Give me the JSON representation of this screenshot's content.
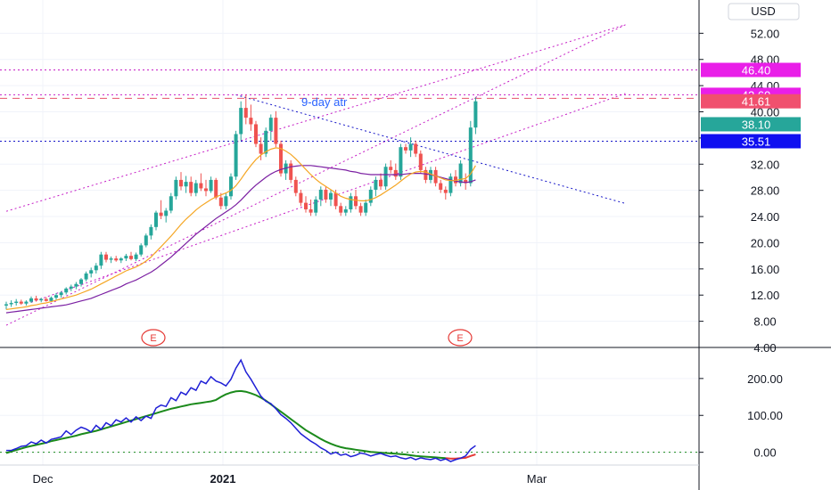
{
  "currency_label": "USD",
  "price_axis": {
    "ticks": [
      "52.00",
      "48.00",
      "44.00",
      "40.00",
      "36.00",
      "32.00",
      "28.00",
      "24.00",
      "20.00",
      "16.00",
      "12.00",
      "8.00",
      "4.00"
    ],
    "range": [
      4,
      53
    ]
  },
  "osc_axis": {
    "ticks": [
      "200.00",
      "100.00",
      "0.00"
    ],
    "range": [
      -25,
      260
    ]
  },
  "date_labels": [
    {
      "text": "Dec",
      "bold": false
    },
    {
      "text": "2021",
      "bold": true
    },
    {
      "text": "Mar",
      "bold": false
    }
  ],
  "price_tags": [
    {
      "label": "46.40",
      "value": 46.4,
      "color": "#e91ee8"
    },
    {
      "label": "42.60",
      "value": 42.6,
      "color": "#e91ee8"
    },
    {
      "label": "41.61",
      "value": 41.61,
      "color": "#f0506e"
    },
    {
      "label": "38.10",
      "value": 38.1,
      "color": "#26a69a"
    },
    {
      "label": "35.51",
      "value": 35.51,
      "color": "#1010f0"
    }
  ],
  "annotation": "9-day atr",
  "earnings_marker": "E",
  "colors": {
    "up": "#26a69a",
    "down": "#ef5350",
    "ma_fast": "#f5a623",
    "ma_slow": "#7b1fa2",
    "osc_fast": "#1f1fd6",
    "osc_slow": "#1b8a1b",
    "osc_slow_tail": "#e53935",
    "trend": "#c61ec6",
    "level": "#1515c8",
    "dashed": "#e8546b"
  },
  "chart_data": [
    {
      "type": "candlestick",
      "title": "",
      "ylabel": "USD",
      "ylim": [
        4,
        53
      ],
      "x_labels": [
        "Dec",
        "2021",
        "Mar"
      ],
      "candles": [
        [
          10.4,
          11.0,
          9.8,
          10.6
        ],
        [
          10.6,
          11.2,
          10.2,
          10.8
        ],
        [
          10.8,
          11.4,
          10.4,
          11.0
        ],
        [
          11.0,
          11.3,
          10.5,
          10.7
        ],
        [
          10.7,
          11.2,
          10.4,
          11.0
        ],
        [
          11.0,
          11.8,
          10.8,
          11.5
        ],
        [
          11.5,
          11.9,
          11.0,
          11.2
        ],
        [
          11.2,
          11.6,
          10.9,
          11.4
        ],
        [
          11.4,
          11.7,
          11.0,
          11.1
        ],
        [
          11.1,
          11.8,
          11.0,
          11.6
        ],
        [
          11.6,
          12.3,
          11.3,
          12.0
        ],
        [
          12.0,
          12.6,
          11.6,
          12.4
        ],
        [
          12.4,
          13.2,
          12.1,
          13.0
        ],
        [
          13.0,
          13.6,
          12.6,
          13.3
        ],
        [
          13.3,
          14.0,
          12.9,
          13.7
        ],
        [
          13.7,
          14.6,
          13.3,
          14.4
        ],
        [
          14.4,
          15.6,
          14.1,
          15.3
        ],
        [
          15.3,
          16.2,
          14.7,
          15.8
        ],
        [
          15.8,
          16.9,
          15.3,
          16.5
        ],
        [
          16.5,
          18.6,
          16.0,
          18.2
        ],
        [
          18.2,
          18.6,
          17.0,
          17.4
        ],
        [
          17.4,
          17.9,
          16.9,
          17.6
        ],
        [
          17.6,
          18.0,
          17.1,
          17.3
        ],
        [
          17.3,
          17.8,
          16.9,
          17.6
        ],
        [
          17.6,
          18.3,
          17.2,
          18.0
        ],
        [
          18.0,
          18.6,
          17.3,
          17.5
        ],
        [
          17.5,
          18.5,
          17.2,
          18.2
        ],
        [
          18.2,
          19.9,
          17.9,
          19.6
        ],
        [
          19.6,
          21.4,
          19.3,
          21.1
        ],
        [
          21.1,
          22.8,
          20.5,
          22.4
        ],
        [
          22.4,
          24.9,
          21.9,
          24.6
        ],
        [
          24.6,
          26.5,
          23.6,
          24.1
        ],
        [
          24.1,
          25.3,
          23.1,
          24.9
        ],
        [
          24.9,
          27.6,
          24.5,
          27.1
        ],
        [
          27.1,
          30.1,
          26.6,
          29.6
        ],
        [
          29.6,
          30.8,
          28.0,
          28.6
        ],
        [
          28.6,
          30.2,
          27.6,
          29.3
        ],
        [
          29.3,
          30.1,
          27.1,
          27.6
        ],
        [
          27.6,
          29.6,
          27.1,
          29.1
        ],
        [
          29.1,
          30.6,
          27.9,
          28.3
        ],
        [
          28.3,
          29.6,
          27.1,
          27.9
        ],
        [
          27.9,
          30.1,
          27.6,
          29.6
        ],
        [
          29.6,
          29.9,
          26.6,
          26.9
        ],
        [
          26.9,
          27.6,
          25.1,
          25.6
        ],
        [
          25.6,
          27.6,
          25.1,
          27.1
        ],
        [
          27.1,
          30.6,
          26.6,
          30.1
        ],
        [
          30.1,
          37.1,
          29.6,
          36.6
        ],
        [
          36.6,
          41.6,
          35.6,
          40.6
        ],
        [
          40.6,
          42.6,
          38.1,
          39.1
        ],
        [
          39.1,
          41.1,
          37.1,
          38.1
        ],
        [
          38.1,
          38.6,
          34.6,
          35.1
        ],
        [
          35.1,
          36.1,
          32.6,
          33.6
        ],
        [
          33.6,
          37.6,
          33.1,
          37.1
        ],
        [
          37.1,
          39.6,
          35.6,
          39.1
        ],
        [
          39.1,
          40.1,
          34.6,
          35.1
        ],
        [
          35.1,
          35.6,
          30.1,
          30.6
        ],
        [
          30.6,
          32.6,
          29.6,
          32.1
        ],
        [
          32.1,
          32.6,
          29.1,
          29.6
        ],
        [
          29.6,
          30.1,
          27.1,
          27.6
        ],
        [
          27.6,
          28.1,
          25.6,
          26.1
        ],
        [
          26.1,
          27.1,
          24.6,
          25.1
        ],
        [
          25.1,
          26.6,
          24.1,
          24.6
        ],
        [
          24.6,
          27.1,
          24.1,
          26.6
        ],
        [
          26.6,
          28.6,
          25.6,
          28.1
        ],
        [
          28.1,
          28.6,
          26.1,
          26.6
        ],
        [
          26.6,
          28.1,
          25.6,
          27.6
        ],
        [
          27.6,
          28.1,
          25.1,
          25.6
        ],
        [
          25.6,
          26.1,
          24.1,
          24.6
        ],
        [
          24.6,
          25.6,
          24.1,
          25.1
        ],
        [
          25.1,
          27.6,
          24.6,
          27.1
        ],
        [
          27.1,
          28.1,
          25.1,
          25.6
        ],
        [
          25.6,
          26.1,
          24.1,
          24.6
        ],
        [
          24.6,
          26.6,
          24.1,
          26.1
        ],
        [
          26.1,
          28.6,
          25.6,
          28.1
        ],
        [
          28.1,
          30.1,
          27.1,
          29.6
        ],
        [
          29.6,
          30.6,
          28.1,
          28.6
        ],
        [
          28.6,
          32.1,
          28.1,
          31.6
        ],
        [
          31.6,
          32.6,
          30.6,
          31.1
        ],
        [
          31.1,
          32.1,
          29.6,
          30.1
        ],
        [
          30.1,
          35.1,
          29.6,
          34.6
        ],
        [
          34.6,
          35.1,
          33.6,
          34.1
        ],
        [
          34.1,
          36.1,
          33.1,
          35.1
        ],
        [
          35.1,
          35.6,
          33.1,
          33.6
        ],
        [
          33.6,
          34.1,
          30.6,
          31.1
        ],
        [
          31.1,
          31.6,
          29.1,
          29.6
        ],
        [
          29.6,
          31.6,
          29.1,
          31.1
        ],
        [
          31.1,
          31.6,
          28.6,
          29.1
        ],
        [
          29.1,
          29.6,
          27.6,
          28.1
        ],
        [
          28.1,
          28.6,
          26.6,
          27.6
        ],
        [
          27.6,
          30.6,
          27.1,
          30.1
        ],
        [
          30.1,
          31.1,
          28.6,
          29.1
        ],
        [
          29.1,
          32.6,
          28.6,
          32.1
        ],
        [
          29.6,
          30.6,
          28.1,
          29.1
        ],
        [
          29.1,
          38.6,
          28.6,
          37.6
        ],
        [
          37.6,
          42.2,
          36.6,
          41.61
        ]
      ],
      "ma_fast": [
        9.8,
        9.9,
        10.0,
        10.1,
        10.2,
        10.4,
        10.5,
        10.7,
        10.8,
        11.0,
        11.2,
        11.4,
        11.6,
        11.8,
        12.0,
        12.3,
        12.6,
        12.9,
        13.3,
        13.7,
        14.1,
        14.5,
        14.9,
        15.3,
        15.7,
        16.0,
        16.3,
        16.7,
        17.2,
        17.8,
        18.6,
        19.4,
        20.2,
        21.0,
        21.9,
        22.8,
        23.6,
        24.3,
        25.0,
        25.6,
        26.1,
        26.6,
        27.0,
        27.3,
        27.6,
        28.0,
        28.7,
        29.7,
        30.8,
        31.8,
        32.7,
        33.4,
        33.9,
        34.3,
        34.5,
        34.4,
        34.0,
        33.5,
        32.8,
        32.0,
        31.2,
        30.4,
        29.7,
        29.1,
        28.6,
        28.1,
        27.6,
        27.1,
        26.8,
        26.6,
        26.5,
        26.4,
        26.4,
        26.6,
        26.9,
        27.3,
        27.8,
        28.3,
        28.8,
        29.4,
        30.0,
        30.5,
        30.8,
        30.9,
        30.8,
        30.5,
        30.2,
        29.9,
        29.6,
        29.5,
        29.5,
        29.7,
        29.8,
        30.5,
        31.8
      ],
      "ma_slow": [
        9.3,
        9.4,
        9.5,
        9.6,
        9.7,
        9.8,
        9.9,
        10.0,
        10.1,
        10.2,
        10.3,
        10.4,
        10.5,
        10.7,
        10.9,
        11.1,
        11.3,
        11.5,
        11.8,
        12.1,
        12.4,
        12.7,
        13.0,
        13.3,
        13.7,
        14.0,
        14.3,
        14.7,
        15.1,
        15.5,
        16.0,
        16.6,
        17.2,
        17.8,
        18.5,
        19.2,
        19.9,
        20.6,
        21.3,
        21.9,
        22.5,
        23.1,
        23.7,
        24.2,
        24.7,
        25.2,
        25.8,
        26.5,
        27.3,
        28.1,
        28.8,
        29.4,
        30.0,
        30.5,
        30.9,
        31.2,
        31.4,
        31.6,
        31.7,
        31.8,
        31.8,
        31.8,
        31.7,
        31.6,
        31.5,
        31.4,
        31.3,
        31.2,
        31.1,
        30.9,
        30.8,
        30.6,
        30.5,
        30.4,
        30.4,
        30.4,
        30.4,
        30.4,
        30.4,
        30.4,
        30.5,
        30.6,
        30.6,
        30.6,
        30.5,
        30.4,
        30.2,
        30.0,
        29.8,
        29.6,
        29.4,
        29.3,
        29.2,
        29.3,
        29.6
      ],
      "trend_lines": [
        {
          "from": [
            0,
            24.8
          ],
          "to": [
            124,
            53.3
          ]
        },
        {
          "from": [
            0,
            7.4
          ],
          "to": [
            124,
            53.3
          ]
        },
        {
          "from": [
            5,
            10.9
          ],
          "to": [
            124,
            42.8
          ]
        }
      ],
      "horizontal_levels": [
        46.4,
        42.6,
        35.51
      ],
      "dashed_level": 42.6,
      "diagonal_level": {
        "from": [
          46,
          42.6
        ],
        "to": [
          124,
          26.0
        ]
      }
    },
    {
      "type": "line",
      "title": "",
      "ylim": [
        -25,
        260
      ],
      "series": [
        {
          "values": [
            5,
            5,
            10,
            16,
            18,
            28,
            23,
            33,
            25,
            35,
            38,
            42,
            58,
            48,
            60,
            68,
            63,
            55,
            73,
            62,
            80,
            72,
            88,
            82,
            93,
            82,
            96,
            86,
            98,
            92,
            120,
            128,
            124,
            148,
            140,
            163,
            156,
            175,
            168,
            193,
            186,
            205,
            193,
            188,
            180,
            198,
            228,
            250,
            218,
            198,
            175,
            152,
            138,
            132,
            118,
            102,
            92,
            80,
            65,
            50,
            40,
            30,
            22,
            12,
            5,
            -5,
            0,
            -8,
            -5,
            -12,
            -8,
            -2,
            -5,
            -10,
            -6,
            -3,
            -8,
            -12,
            -10,
            -15,
            -18,
            -14,
            -20,
            -15,
            -18,
            -20,
            -16,
            -22,
            -18,
            -25,
            -20,
            -16,
            -10,
            8,
            18
          ]
        },
        {
          "values": [
            -2,
            2,
            6,
            10,
            14,
            17,
            20,
            23,
            26,
            30,
            33,
            36,
            39,
            42,
            45,
            49,
            52,
            55,
            58,
            62,
            66,
            70,
            74,
            78,
            82,
            86,
            90,
            94,
            98,
            102,
            106,
            110,
            114,
            118,
            121,
            124,
            127,
            130,
            132,
            134,
            136,
            138,
            142,
            150,
            157,
            162,
            165,
            166,
            164,
            160,
            155,
            148,
            140,
            130,
            120,
            110,
            100,
            90,
            80,
            70,
            60,
            52,
            44,
            36,
            29,
            23,
            18,
            14,
            11,
            9,
            7,
            5,
            3,
            1,
            0,
            -1,
            -2,
            -3,
            -4,
            -5,
            -6,
            -8,
            -10,
            -11,
            -12,
            -13,
            -14,
            -15,
            -16,
            -17,
            -17,
            -16,
            -15,
            -10,
            -6
          ]
        }
      ],
      "reference_level": 0
    }
  ]
}
